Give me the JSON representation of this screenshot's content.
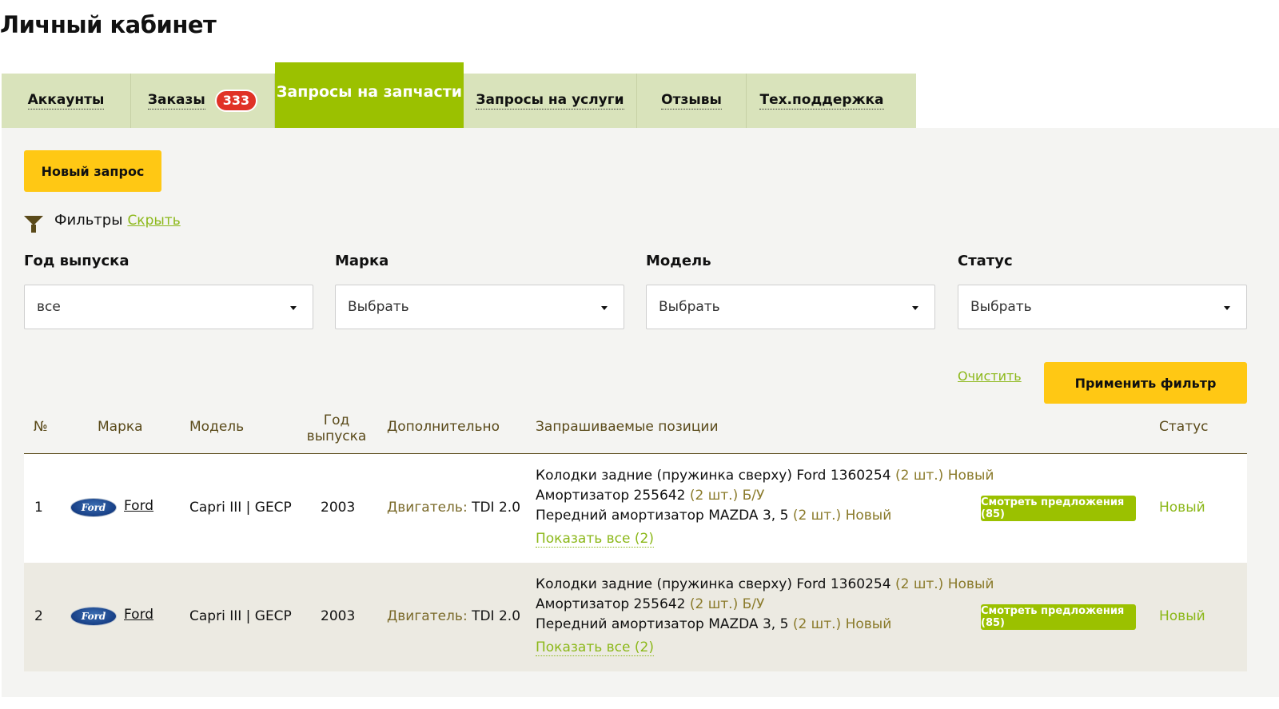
{
  "page_title": "Личный кабинет",
  "tabs": [
    {
      "label": "Аккаунты"
    },
    {
      "label": "Заказы",
      "badge": "333"
    },
    {
      "label": "Запросы на запчасти",
      "active": true
    },
    {
      "label": "Запросы на услуги"
    },
    {
      "label": "Отзывы"
    },
    {
      "label": "Тех.поддержка"
    }
  ],
  "new_request_label": "Новый запрос",
  "filters": {
    "title": "Фильтры",
    "hide_label": "Скрыть",
    "fields": [
      {
        "label": "Год выпуска",
        "value": "все"
      },
      {
        "label": "Марка",
        "value": "Выбрать"
      },
      {
        "label": "Модель",
        "value": "Выбрать"
      },
      {
        "label": "Статус",
        "value": "Выбрать"
      }
    ],
    "clear_label": "Очистить",
    "apply_label": "Применить фильтр"
  },
  "table": {
    "headers": {
      "num": "№",
      "brand": "Марка",
      "model": "Модель",
      "year_line1": "Год",
      "year_line2": "выпуска",
      "extra": "Дополнительно",
      "positions": "Запрашиваемые позиции",
      "status": "Статус"
    },
    "rows": [
      {
        "num": "1",
        "brand": "Ford",
        "logo_text": "Ford",
        "model": "Capri III | GECP",
        "year": "2003",
        "extra_label": "Двигатель:",
        "extra_value": "TDI 2.0",
        "positions": [
          {
            "name": "Колодки задние (пружинка сверху) Ford 1360254",
            "qty": "(2 шт.)",
            "cond": "Новый"
          },
          {
            "name": "Амортизатор 255642",
            "qty": "(2 шт.)",
            "cond": "Б/У"
          },
          {
            "name": "Передний амортизатор MAZDA 3, 5",
            "qty": "(2 шт.)",
            "cond": "Новый"
          }
        ],
        "show_all": "Показать все (2)",
        "offers_label": "Смотреть предложения (85)",
        "status": "Новый"
      },
      {
        "num": "2",
        "brand": "Ford",
        "logo_text": "Ford",
        "model": "Capri III | GECP",
        "year": "2003",
        "extra_label": "Двигатель:",
        "extra_value": "TDI 2.0",
        "positions": [
          {
            "name": "Колодки задние (пружинка сверху) Ford 1360254",
            "qty": "(2 шт.)",
            "cond": "Новый"
          },
          {
            "name": "Амортизатор 255642",
            "qty": "(2 шт.)",
            "cond": "Б/У"
          },
          {
            "name": "Передний амортизатор MAZDA 3, 5",
            "qty": "(2 шт.)",
            "cond": "Новый"
          }
        ],
        "show_all": "Показать все (2)",
        "offers_label": "Смотреть предложения (85)",
        "status": "Новый"
      }
    ]
  },
  "colors": {
    "accent_green": "#9bc100",
    "tab_bg": "#d9e3bb",
    "button_yellow": "#ffc814",
    "badge_red": "#e03226"
  }
}
